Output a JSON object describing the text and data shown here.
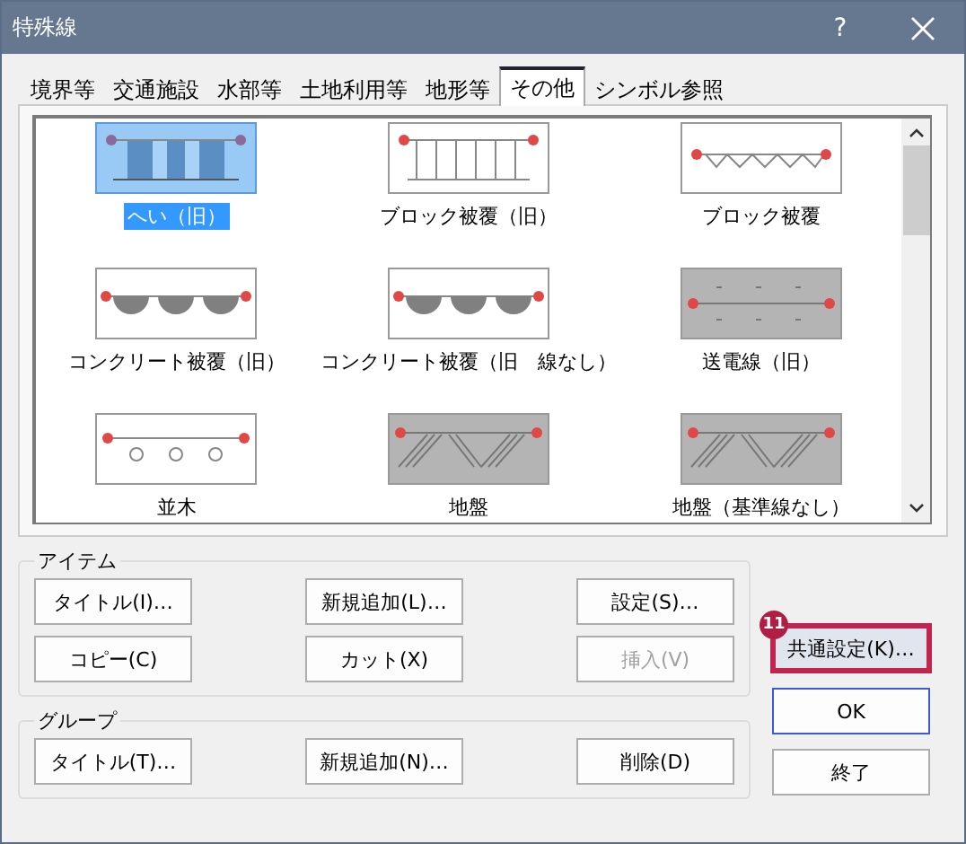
{
  "window": {
    "title": "特殊線",
    "help": "?"
  },
  "tabs": [
    {
      "label": "境界等",
      "selected": false
    },
    {
      "label": "交通施設",
      "selected": false
    },
    {
      "label": "水部等",
      "selected": false
    },
    {
      "label": "土地利用等",
      "selected": false
    },
    {
      "label": "地形等",
      "selected": false
    },
    {
      "label": "その他",
      "selected": true
    },
    {
      "label": "シンボル参照",
      "selected": false
    }
  ],
  "symbols": [
    {
      "kind": "fence",
      "label": "へい（旧）",
      "selected": true
    },
    {
      "kind": "block-old",
      "label": "ブロック被覆（旧）",
      "selected": false
    },
    {
      "kind": "block",
      "label": "ブロック被覆",
      "selected": false
    },
    {
      "kind": "concrete",
      "label": "コンクリート被覆（旧）",
      "selected": false
    },
    {
      "kind": "concrete",
      "label": "コンクリート被覆（旧　線なし）",
      "selected": false
    },
    {
      "kind": "power",
      "label": "送電線（旧）",
      "selected": false
    },
    {
      "kind": "trees",
      "label": "並木",
      "selected": false
    },
    {
      "kind": "ground",
      "label": "地盤",
      "selected": false
    },
    {
      "kind": "ground",
      "label": "地盤（基準線なし）",
      "selected": false
    }
  ],
  "item_group": {
    "title": "アイテム",
    "buttons": [
      {
        "label": "タイトル(I)…",
        "disabled": false
      },
      {
        "label": "新規追加(L)…",
        "disabled": false
      },
      {
        "label": "設定(S)…",
        "disabled": false
      },
      {
        "label": "コピー(C)",
        "disabled": false
      },
      {
        "label": "カット(X)",
        "disabled": false
      },
      {
        "label": "挿入(V)",
        "disabled": true
      }
    ]
  },
  "group_group": {
    "title": "グループ",
    "buttons": [
      {
        "label": "タイトル(T)…",
        "disabled": false
      },
      {
        "label": "新規追加(N)…",
        "disabled": false
      },
      {
        "label": "削除(D)",
        "disabled": false
      }
    ]
  },
  "side_buttons": [
    {
      "label": "共通設定(K)…",
      "kind": "highlighted",
      "marker": "11"
    },
    {
      "label": "OK",
      "kind": "default"
    },
    {
      "label": "終了",
      "kind": "normal"
    }
  ]
}
